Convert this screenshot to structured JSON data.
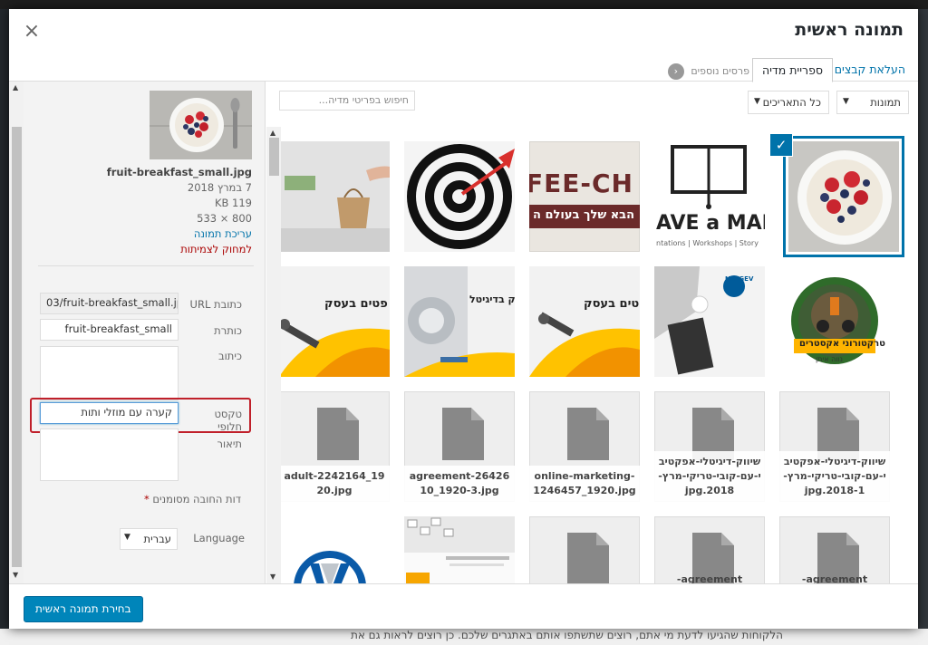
{
  "modal": {
    "title": "תמונה ראשית",
    "close_symbol": "×"
  },
  "tabs": {
    "upload": "העלאת קבצים",
    "library": "ספריית מדיה",
    "more_plugins": "פרסים נוספים"
  },
  "details": {
    "filename": "fruit-breakfast_small.jpg",
    "date": "7 במרץ 2018",
    "size": "119 KB",
    "dimensions": "800 × 533",
    "edit_link": "עריכת תמונה",
    "delete_link": "למחוק לצמיתות"
  },
  "fields": {
    "url_label": "כתובת URL",
    "url_value": "03/fruit-breakfast_small.jpg",
    "title_label": "כותרת",
    "title_value": "fruit-breakfast_small",
    "caption_label": "כיתוב",
    "alt_label": "טקסט חלופי",
    "alt_value": "קערה עם מוזלי ותות",
    "description_label": "תיאור",
    "required_note": "דות החובה מסומנים",
    "required_star": "*",
    "language_label": "Language",
    "language_value": "עברית"
  },
  "filters": {
    "type_value": "תמונות",
    "date_value": "כל התאריכים",
    "search_placeholder": "חיפוש בפריטי מדיה..."
  },
  "grid": {
    "captions": [
      "שיווק-דיגיטלי-אפקטיב י-עם-קובי-טריקי-מרץ-2018-1.jpg",
      "שיווק-דיגיטלי-אפקטיב י-עם-קובי-טריקי-מרץ-2018.jpg",
      "online-marketing-1246457_1920.jpg",
      "agreement-2642610_1920-3.jpg",
      "adult-2242164_1920.jpg",
      "agreement-",
      "agreement-"
    ],
    "thumb_text": {
      "coffee": "FEE-CH",
      "coffee_sub": "הבא שלך בעולם ה",
      "save": "AVE a MAR",
      "save_sub": "ntations | Workshops | Story",
      "biz1": "פטים בעסק",
      "digital": "ק בדיגיטל",
      "netgev": "NETGEV",
      "tractor": "טרקטורוני אקסטרים",
      "tractor_sub": "נווה איתן"
    }
  },
  "toolbar": {
    "select_button": "בחירת תמונה ראשית"
  },
  "background": {
    "bottom_text": "הלקוחות שהגיעו לדעת מי אתם, רוצים שתשתפו אותם באתגרים שלכם. כן רוצים לראות גם את"
  },
  "colors": {
    "accent": "#0073aa",
    "button": "#0085ba",
    "highlight": "#c0202a"
  }
}
